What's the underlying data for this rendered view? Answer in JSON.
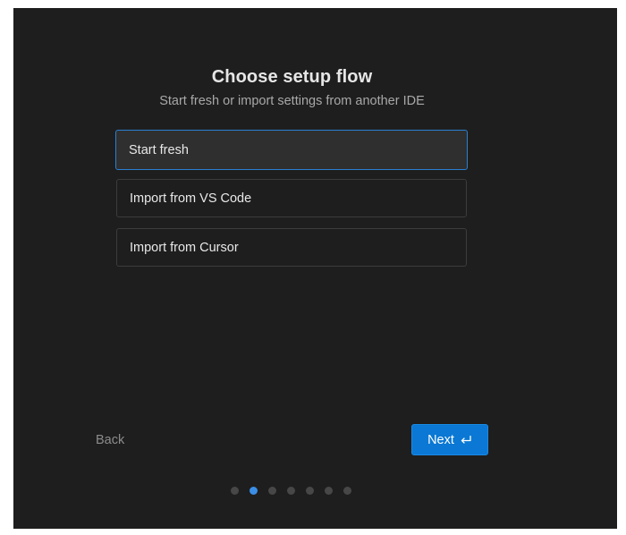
{
  "header": {
    "title": "Choose setup flow",
    "subtitle": "Start fresh or import settings from another IDE"
  },
  "options": [
    {
      "label": "Start fresh",
      "selected": true
    },
    {
      "label": "Import from VS Code",
      "selected": false
    },
    {
      "label": "Import from Cursor",
      "selected": false
    }
  ],
  "footer": {
    "back_label": "Back",
    "next_label": "Next",
    "next_icon": "enter-key-icon"
  },
  "pagination": {
    "total_steps": 7,
    "current_step": 2
  },
  "colors": {
    "background": "#1e1e1e",
    "accent": "#0a78d4",
    "selected_border": "#2b7fd4",
    "active_dot": "#3b8ee6"
  }
}
